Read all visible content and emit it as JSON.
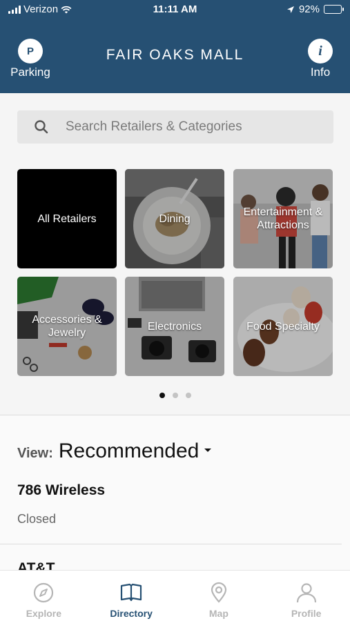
{
  "status_bar": {
    "carrier": "Verizon",
    "time": "11:11 AM",
    "battery": "92%"
  },
  "header": {
    "title": "FAIR OAKS MALL",
    "left_button": {
      "icon_letter": "P",
      "label": "Parking"
    },
    "right_button": {
      "icon_letter": "i",
      "label": "Info"
    }
  },
  "search": {
    "placeholder": "Search Retailers & Categories"
  },
  "categories": [
    {
      "label": "All Retailers"
    },
    {
      "label": "Dining"
    },
    {
      "label": "Entertainment & Attractions"
    },
    {
      "label": "Accessories & Jewelry"
    },
    {
      "label": "Electronics"
    },
    {
      "label": "Food Specialty"
    }
  ],
  "pagination": {
    "current": 1,
    "total": 3
  },
  "view": {
    "label": "View:",
    "value": "Recommended"
  },
  "retailers": [
    {
      "name": "786 Wireless",
      "status": "Closed"
    },
    {
      "name": "AT&T"
    }
  ],
  "tabs": [
    {
      "label": "Explore",
      "icon": "compass-icon",
      "active": false
    },
    {
      "label": "Directory",
      "icon": "book-icon",
      "active": true
    },
    {
      "label": "Map",
      "icon": "map-pin-icon",
      "active": false
    },
    {
      "label": "Profile",
      "icon": "person-icon",
      "active": false
    }
  ],
  "colors": {
    "brand": "#265073",
    "inactive": "#b5b5b5"
  }
}
